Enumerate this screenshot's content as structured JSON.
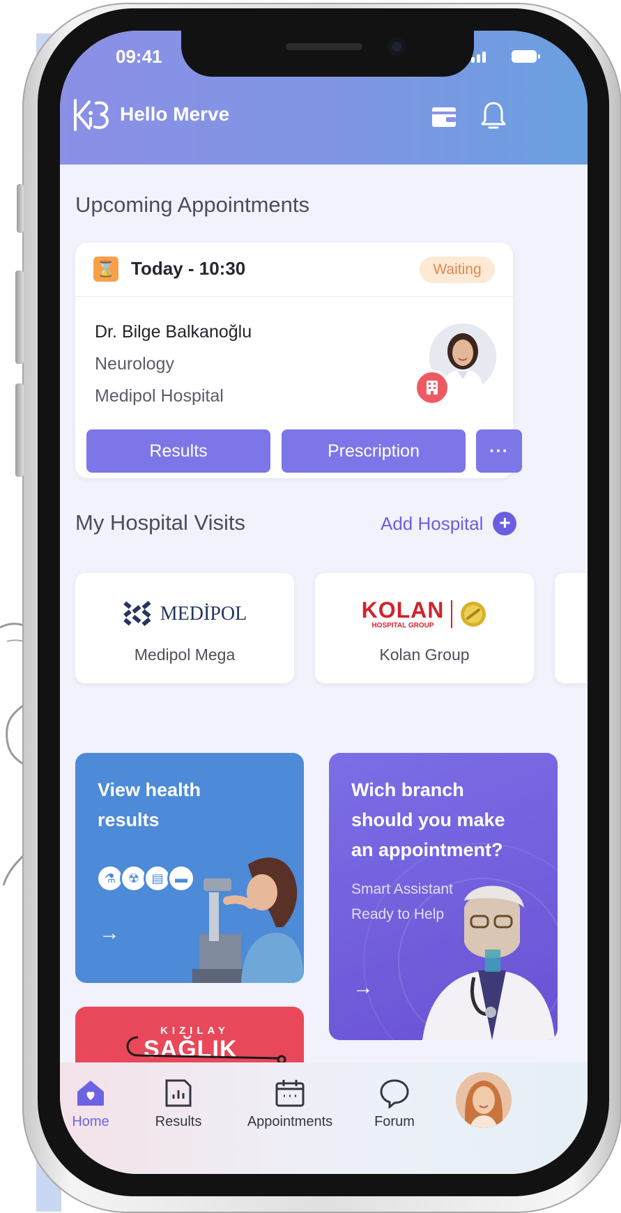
{
  "status_bar": {
    "time": "09:41"
  },
  "header": {
    "greeting": "Hello Merve"
  },
  "appointments": {
    "section_title": "Upcoming Appointments",
    "date_time": "Today - 10:30",
    "status": "Waiting",
    "doctor_name": "Dr. Bilge Balkanoğlu",
    "department": "Neurology",
    "hospital": "Medipol Hospital",
    "results_label": "Results",
    "prescription_label": "Prescription",
    "more_label": "···"
  },
  "hospital_visits": {
    "section_title": "My Hospital Visits",
    "add_label": "Add Hospital",
    "items": [
      {
        "logo_text": "MEDİPOL",
        "name": "Medipol Mega"
      },
      {
        "logo_text": "KOLAN",
        "logo_sub": "HOSPITAL GROUP",
        "name": "Kolan Group"
      }
    ]
  },
  "features": {
    "health": {
      "title_line1": "View health",
      "title_line2": "results"
    },
    "branch": {
      "title_line1": "Wich branch",
      "title_line2": "should you make",
      "title_line3": "an appointment?",
      "sub_line1": "Smart Assistant",
      "sub_line2": "Ready to Help"
    },
    "kizilay": {
      "top": "KIZILAY",
      "main": "SAĞLIK"
    }
  },
  "bottom_nav": {
    "home": "Home",
    "results": "Results",
    "appointments": "Appointments",
    "forum": "Forum"
  },
  "colors": {
    "accent": "#7c76e8",
    "link": "#6a5fe0",
    "waiting_badge_bg": "#fde9d4",
    "waiting_badge_text": "#e0894a",
    "health_card": "#4d8ad8",
    "branch_card": "#6a52d3",
    "kizilay_card": "#e8485a"
  }
}
